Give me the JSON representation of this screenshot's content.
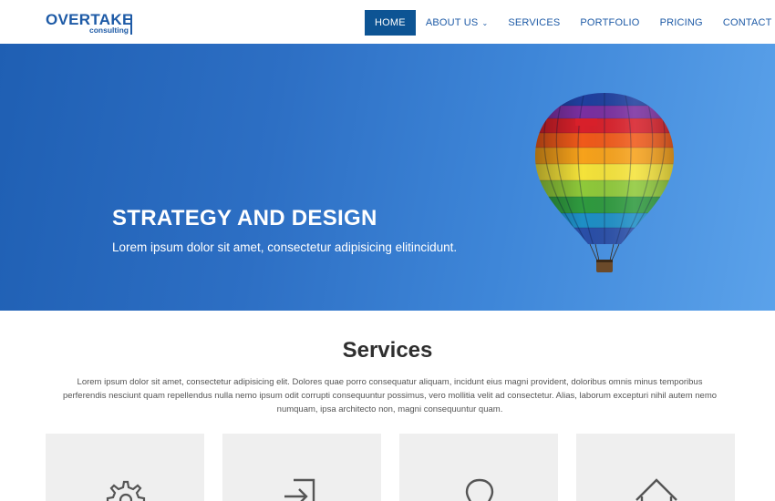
{
  "logo": {
    "main": "OVERTAKE",
    "sub": "consulting"
  },
  "nav": [
    {
      "label": "HOME",
      "active": true
    },
    {
      "label": "ABOUT US",
      "dropdown": true
    },
    {
      "label": "SERVICES"
    },
    {
      "label": "PORTFOLIO"
    },
    {
      "label": "PRICING"
    },
    {
      "label": "CONTACT"
    }
  ],
  "nav_caret": "⌄",
  "hero": {
    "title": "STRATEGY AND DESIGN",
    "subtitle": "Lorem ipsum dolor sit amet, consectetur adipisicing elitincidunt."
  },
  "services": {
    "title": "Services",
    "description": "Lorem ipsum dolor sit amet, consectetur adipisicing elit. Dolores quae porro consequatur aliquam, incidunt eius magni provident, doloribus omnis minus temporibus perferendis nesciunt quam repellendus nulla nemo ipsum odit corrupti consequuntur possimus, vero mollitia velit ad consectetur. Alias, laborum excepturi nihil autem nemo numquam, ipsa architecto non, magni consequuntur quam.",
    "cards": [
      {
        "icon": "gear-icon"
      },
      {
        "icon": "sign-in-icon"
      },
      {
        "icon": "lightbulb-icon"
      },
      {
        "icon": "home-icon"
      }
    ]
  },
  "colors": {
    "brand": "#1d5aa6",
    "nav_active": "#0d5494",
    "card_bg": "#efefef"
  }
}
